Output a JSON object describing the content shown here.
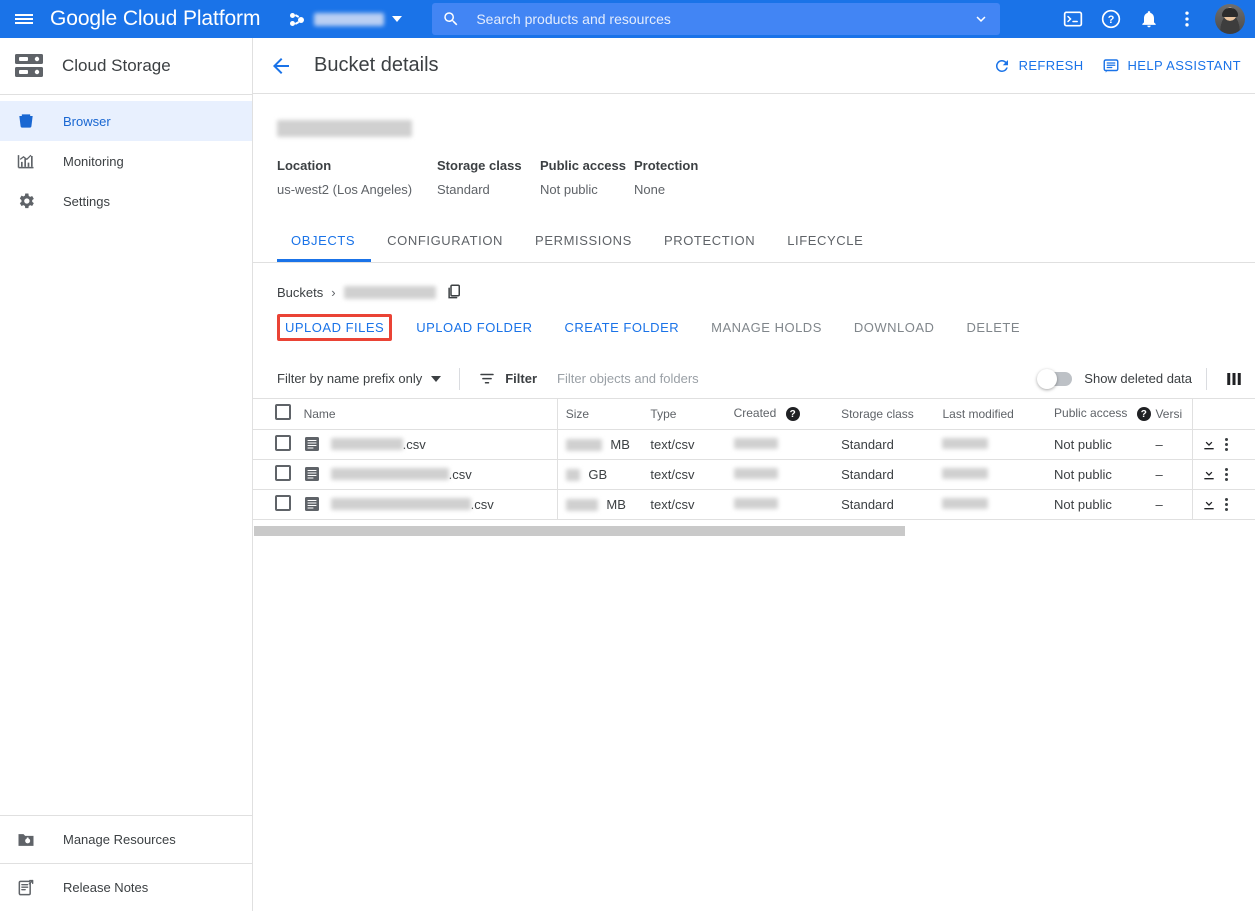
{
  "topbar": {
    "brand": "Google Cloud Platform",
    "project_name_redacted": "",
    "search_placeholder": "Search products and resources",
    "icons": {
      "menu": "hamburger-menu-icon",
      "project_picker": "project-picker-icon",
      "search": "search-icon",
      "search_caret": "chevron-down-icon",
      "cloud_shell": "cloud-shell-terminal-icon",
      "help": "help-icon",
      "notifications": "notifications-bell-icon",
      "more": "more-vert-icon",
      "avatar": "user-avatar"
    }
  },
  "sidebar": {
    "product_title": "Cloud Storage",
    "items": [
      {
        "label": "Browser",
        "icon": "bucket-icon",
        "active": true
      },
      {
        "label": "Monitoring",
        "icon": "chart-icon",
        "active": false
      },
      {
        "label": "Settings",
        "icon": "gear-icon",
        "active": false
      }
    ],
    "bottom_items": [
      {
        "label": "Manage Resources",
        "icon": "manage-resources-icon"
      },
      {
        "label": "Release Notes",
        "icon": "release-notes-icon"
      }
    ]
  },
  "page": {
    "title": "Bucket details",
    "back_icon": "back-arrow-icon",
    "actions": [
      {
        "label": "REFRESH",
        "icon": "refresh-icon"
      },
      {
        "label": "HELP ASSISTANT",
        "icon": "help-assistant-icon"
      }
    ]
  },
  "bucket": {
    "name_redacted": "",
    "meta": [
      {
        "label": "Location",
        "value": "us-west2 (Los Angeles)"
      },
      {
        "label": "Storage class",
        "value": "Standard"
      },
      {
        "label": "Public access",
        "value": "Not public"
      },
      {
        "label": "Protection",
        "value": "None"
      }
    ]
  },
  "tabs": [
    {
      "label": "OBJECTS",
      "active": true
    },
    {
      "label": "CONFIGURATION",
      "active": false
    },
    {
      "label": "PERMISSIONS",
      "active": false
    },
    {
      "label": "PROTECTION",
      "active": false
    },
    {
      "label": "LIFECYCLE",
      "active": false
    }
  ],
  "breadcrumb": {
    "root": "Buckets",
    "separator": "›",
    "current_redacted": "",
    "copy_icon": "copy-icon"
  },
  "object_actions": [
    {
      "label": "UPLOAD FILES",
      "enabled": true,
      "highlighted": true
    },
    {
      "label": "UPLOAD FOLDER",
      "enabled": true,
      "highlighted": false
    },
    {
      "label": "CREATE FOLDER",
      "enabled": true,
      "highlighted": false
    },
    {
      "label": "MANAGE HOLDS",
      "enabled": false,
      "highlighted": false
    },
    {
      "label": "DOWNLOAD",
      "enabled": false,
      "highlighted": false
    },
    {
      "label": "DELETE",
      "enabled": false,
      "highlighted": false
    }
  ],
  "filterbar": {
    "prefix_select_label": "Filter by name prefix only",
    "filter_label": "Filter",
    "filter_placeholder": "Filter objects and folders",
    "show_deleted_label": "Show deleted data",
    "show_deleted_on": false,
    "columns_icon": "column-display-options-icon"
  },
  "table": {
    "columns": [
      {
        "key": "checkbox",
        "label": ""
      },
      {
        "key": "name",
        "label": "Name"
      },
      {
        "key": "size",
        "label": "Size"
      },
      {
        "key": "type",
        "label": "Type"
      },
      {
        "key": "created",
        "label": "Created",
        "help": true
      },
      {
        "key": "storageclass",
        "label": "Storage class"
      },
      {
        "key": "lastmodified",
        "label": "Last modified"
      },
      {
        "key": "publicaccess",
        "label": "Public access",
        "help": true
      },
      {
        "key": "version",
        "label": "Versi"
      },
      {
        "key": "actions",
        "label": ""
      }
    ],
    "rows": [
      {
        "name_suffix": ".csv",
        "name_redact_width": 72,
        "size_unit": "MB",
        "size_redact_width": 36,
        "type": "text/csv",
        "created_redact_width": 44,
        "storage_class": "Standard",
        "last_modified_redact_width": 46,
        "public_access": "Not public",
        "version": "–"
      },
      {
        "name_suffix": ".csv",
        "name_redact_width": 118,
        "size_unit": "GB",
        "size_redact_width": 14,
        "type": "text/csv",
        "created_redact_width": 44,
        "storage_class": "Standard",
        "last_modified_redact_width": 46,
        "public_access": "Not public",
        "version": "–"
      },
      {
        "name_suffix": ".csv",
        "name_redact_width": 140,
        "size_unit": "MB",
        "size_redact_width": 32,
        "type": "text/csv",
        "created_redact_width": 44,
        "storage_class": "Standard",
        "last_modified_redact_width": 46,
        "public_access": "Not public",
        "version": "–"
      }
    ]
  },
  "colors": {
    "brand_blue": "#1a73e8",
    "header_blue": "#1a73e8",
    "search_blue": "#4285f4",
    "active_nav_bg": "#e8f0fe",
    "active_nav_fg": "#1967d2",
    "highlight_red": "#ea4335",
    "text_primary": "#3c4043",
    "text_secondary": "#5f6368",
    "border": "#e0e0e0"
  }
}
